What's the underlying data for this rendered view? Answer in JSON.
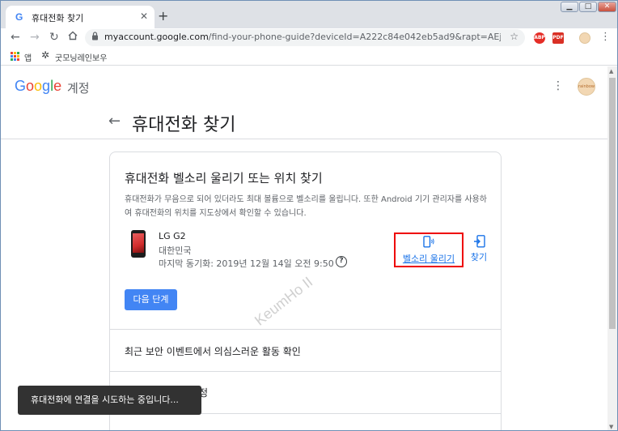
{
  "browser": {
    "tab_title": "휴대전화 찾기",
    "tab_favicon": "G",
    "close_glyph": "✕",
    "new_tab_glyph": "+",
    "url_host": "myaccount.google.com",
    "url_path": "/find-your-phone-guide?deviceId=A222c84e042eb5ad9&rapt=AEjHL4NTN…",
    "window_controls": [
      "▁",
      "□",
      "✕"
    ],
    "nav_icons": [
      "back-arrow-icon",
      "forward-arrow-icon",
      "reload-icon",
      "home-icon"
    ],
    "extensions": [
      {
        "name": "adblock-icon",
        "label": "ABP",
        "color": "#e52d27"
      },
      {
        "name": "pdf-icon",
        "label": "PDF",
        "color": "#d93025"
      },
      {
        "name": "profile-avatar-icon",
        "label": "",
        "color": "#f2d7b3"
      }
    ]
  },
  "bookmarks": {
    "apps_label": "앱",
    "items": [
      {
        "label": "굿모닝레인보우"
      }
    ]
  },
  "header": {
    "logo": {
      "G": "G",
      "o1": "o",
      "o2": "o",
      "g": "g",
      "l": "l",
      "e": "e"
    },
    "suffix": "계정",
    "menu_glyph": "⋮",
    "avatar_text": "rainbow"
  },
  "page": {
    "back_glyph": "←",
    "title": "휴대전화 찾기"
  },
  "card": {
    "title": "휴대전화 벨소리 울리기 또는 위치 찾기",
    "description": "휴대전화가 무음으로 되어 있더라도 최대 볼륨으로 벨소리를 울립니다. 또한 Android 기기 관리자를 사용하여 휴대전화의 위치를 지도상에서 확인할 수 있습니다.",
    "device": {
      "name": "LG G2",
      "country": "대한민국",
      "last_sync": "마지막 동기화: 2019년 12월 14일 오전 9:50",
      "help_glyph": "?"
    },
    "ring_button": "벨소리 울리기",
    "find_button": "찾기",
    "next_button": "다음 단계",
    "rows": [
      {
        "label": "최근 보안 이벤트에서 의심스러운 활동 확인"
      },
      {
        "label": "정"
      }
    ]
  },
  "watermark": "KeumHo II",
  "toast": "휴대전화에 연결을 시도하는 중입니다...",
  "colors": {
    "accent": "#1a73e8",
    "button": "#4285f4",
    "highlight_border": "#ee0000"
  }
}
